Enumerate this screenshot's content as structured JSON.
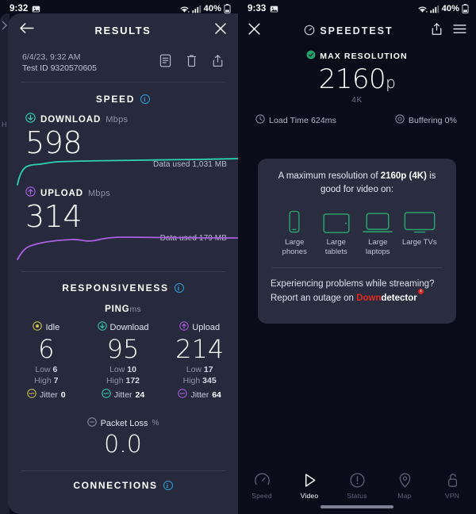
{
  "left": {
    "status_bar": {
      "time": "9:32",
      "battery_percent": "40%",
      "icons": [
        "photo-icon",
        "wifi-icon",
        "cellular-signal-icon",
        "battery-icon"
      ]
    },
    "header": {
      "back_icon": "back-arrow-icon",
      "title": "RESULTS",
      "close_icon": "close-icon"
    },
    "meta": {
      "datetime": "6/4/23, 9:32 AM",
      "test_id": "Test ID 9320570605",
      "actions": [
        "notes-icon",
        "trash-icon",
        "share-icon"
      ]
    },
    "speed_section": {
      "title": "SPEED",
      "info_icon": "info-icon",
      "download": {
        "label": "DOWNLOAD",
        "unit": "Mbps",
        "value": "598",
        "data_used": "Data used 1,031 MB",
        "color": "#2fd1b4",
        "icon": "download-circle-icon"
      },
      "upload": {
        "label": "UPLOAD",
        "unit": "Mbps",
        "value": "314",
        "data_used": "Data used 179 MB",
        "color": "#a85fe0",
        "icon": "upload-circle-icon"
      }
    },
    "responsiveness": {
      "title": "RESPONSIVENESS",
      "info_icon": "info-icon",
      "ping_label": "PING",
      "ping_unit": "ms",
      "columns": [
        {
          "name": "Idle",
          "icon": "idle-circle-icon",
          "color": "#d4c84a",
          "value": "6",
          "low_label": "Low",
          "low": "6",
          "high_label": "High",
          "high": "7",
          "jitter_label": "Jitter",
          "jitter": "0"
        },
        {
          "name": "Download",
          "icon": "download-circle-icon",
          "color": "#2fd1b4",
          "value": "95",
          "low_label": "Low",
          "low": "10",
          "high_label": "High",
          "high": "172",
          "jitter_label": "Jitter",
          "jitter": "24"
        },
        {
          "name": "Upload",
          "icon": "upload-circle-icon",
          "color": "#a85fe0",
          "value": "214",
          "low_label": "Low",
          "low": "17",
          "high_label": "High",
          "high": "345",
          "jitter_label": "Jitter",
          "jitter": "64"
        }
      ],
      "packet_loss": {
        "label": "Packet Loss",
        "unit": "%",
        "value": "0.0",
        "icon": "packet-loss-icon"
      }
    },
    "connections": {
      "title": "CONNECTIONS",
      "info_icon": "info-icon"
    }
  },
  "right": {
    "status_bar": {
      "time": "9:33",
      "battery_percent": "40%"
    },
    "header": {
      "close_icon": "close-icon",
      "brand": "SPEEDTEST",
      "brand_icon": "speedometer-icon",
      "share_icon": "share-icon",
      "menu_icon": "hamburger-menu-icon"
    },
    "max_resolution": {
      "label": "MAX RESOLUTION",
      "check_icon": "check-circle-icon",
      "value": "2160",
      "suffix": "p",
      "subtitle": "4K",
      "accent": "#24a36b"
    },
    "stats": [
      {
        "label": "Load Time 624ms",
        "icon": "load-time-icon"
      },
      {
        "label": "Buffering 0%",
        "icon": "buffering-icon"
      }
    ],
    "video_card": {
      "title_prefix": "A maximum resolution of ",
      "title_bold": "2160p (4K)",
      "title_suffix": " is",
      "title_line2": "good for video on:",
      "devices": [
        {
          "label": "Large phones",
          "icon": "phone-icon"
        },
        {
          "label": "Large tablets",
          "icon": "tablet-icon"
        },
        {
          "label": "Large laptops",
          "icon": "laptop-icon"
        },
        {
          "label": "Large TVs",
          "icon": "tv-icon"
        }
      ],
      "footer_line1": "Experiencing problems while streaming?",
      "footer_line2_prefix": "Report an outage on ",
      "brand_down": "Down",
      "brand_detector": "detector",
      "device_color": "#2aa86f"
    },
    "tabs": [
      {
        "label": "Speed",
        "icon": "speedometer-icon",
        "active": false
      },
      {
        "label": "Video",
        "icon": "play-triangle-icon",
        "active": true
      },
      {
        "label": "Status",
        "icon": "alert-circle-icon",
        "active": false
      },
      {
        "label": "Map",
        "icon": "map-pin-icon",
        "active": false
      },
      {
        "label": "VPN",
        "icon": "unlock-icon",
        "active": false
      }
    ]
  }
}
